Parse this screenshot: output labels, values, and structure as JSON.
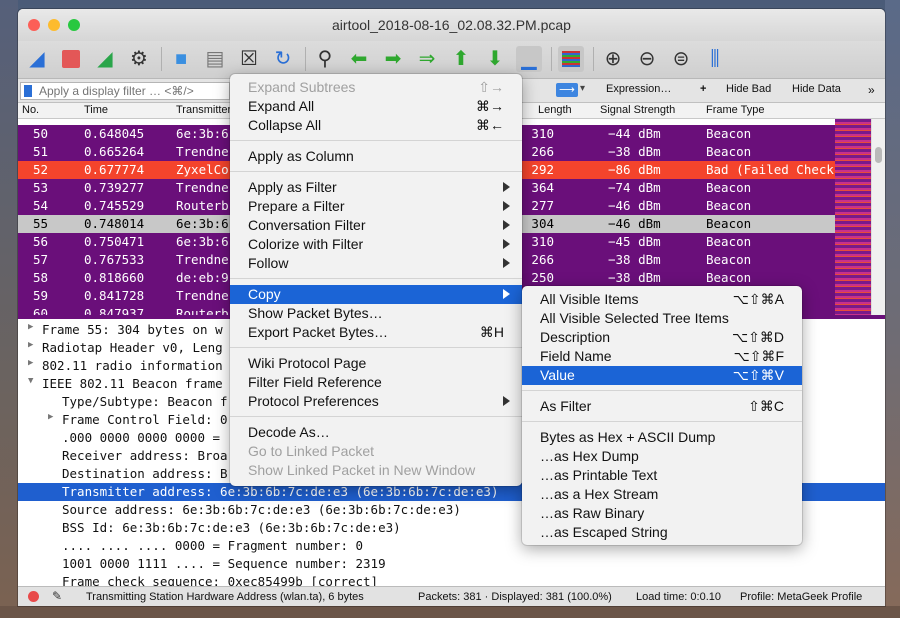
{
  "window": {
    "title": "airtool_2018-08-16_02.08.32.PM.pcap"
  },
  "filter": {
    "placeholder": "Apply a display filter … <⌘/>",
    "expression_label": "Expression…",
    "plus_label": "+",
    "hide_bad_label": "Hide Bad",
    "hide_data_label": "Hide Data"
  },
  "columns": {
    "no": "No.",
    "time": "Time",
    "transmitter": "Transmitter",
    "length": "Length",
    "signal": "Signal Strength",
    "frame_type": "Frame Type"
  },
  "packets": [
    {
      "no": "50",
      "time": "0.648045",
      "tx": "6e:3b:6",
      "len": "310",
      "sig": "−44 dBm",
      "type": "Beacon"
    },
    {
      "no": "51",
      "time": "0.665264",
      "tx": "Trendne",
      "len": "266",
      "sig": "−38 dBm",
      "type": "Beacon"
    },
    {
      "no": "52",
      "time": "0.677774",
      "tx": "ZyxelCo",
      "len": "292",
      "sig": "−86 dBm",
      "type": "Bad (Failed Check"
    },
    {
      "no": "53",
      "time": "0.739277",
      "tx": "Trendne",
      "len": "364",
      "sig": "−74 dBm",
      "type": "Beacon"
    },
    {
      "no": "54",
      "time": "0.745529",
      "tx": "Routerb",
      "len": "277",
      "sig": "−46 dBm",
      "type": "Beacon"
    },
    {
      "no": "55",
      "time": "0.748014",
      "tx": "6e:3b:6",
      "len": "304",
      "sig": "−46 dBm",
      "type": "Beacon"
    },
    {
      "no": "56",
      "time": "0.750471",
      "tx": "6e:3b:6",
      "len": "310",
      "sig": "−45 dBm",
      "type": "Beacon"
    },
    {
      "no": "57",
      "time": "0.767533",
      "tx": "Trendne",
      "len": "266",
      "sig": "−38 dBm",
      "type": "Beacon"
    },
    {
      "no": "58",
      "time": "0.818660",
      "tx": "de:eb:9",
      "len": "250",
      "sig": "−38 dBm",
      "type": "Beacon"
    },
    {
      "no": "59",
      "time": "0.841728",
      "tx": "Trendne",
      "len": "",
      "sig": "",
      "type": ""
    },
    {
      "no": "60",
      "time": "0.847937",
      "tx": "Routerb",
      "len": "",
      "sig": "",
      "type": ""
    }
  ],
  "details": [
    {
      "text": "Frame 55: 304 bytes on w",
      "tw": "▶"
    },
    {
      "text": "Radiotap Header v0, Leng",
      "tw": "▶"
    },
    {
      "text": "802.11 radio information",
      "tw": "▶"
    },
    {
      "text": "IEEE 802.11 Beacon frame",
      "tw": "▼"
    },
    {
      "text": "Type/Subtype: Beacon f",
      "tw": ""
    },
    {
      "text": "Frame Control Field: 0",
      "tw": "▶"
    },
    {
      "text": ".000 0000 0000 0000 =",
      "tw": ""
    },
    {
      "text": "Receiver address: Broa",
      "tw": ""
    },
    {
      "text": "Destination address: B",
      "tw": ""
    },
    {
      "text": "Transmitter address: 6e:3b:6b:7c:de:e3 (6e:3b:6b:7c:de:e3)",
      "tw": ""
    },
    {
      "text": "Source address: 6e:3b:6b:7c:de:e3 (6e:3b:6b:7c:de:e3)",
      "tw": ""
    },
    {
      "text": "BSS Id: 6e:3b:6b:7c:de:e3 (6e:3b:6b:7c:de:e3)",
      "tw": ""
    },
    {
      "text": ".... .... .... 0000 = Fragment number: 0",
      "tw": ""
    },
    {
      "text": "1001 0000 1111 .... = Sequence number: 2319",
      "tw": ""
    },
    {
      "text": "Frame check sequence: 0xec85499b [correct]",
      "tw": ""
    }
  ],
  "status": {
    "field": "Transmitting Station Hardware Address (wlan.ta), 6 bytes",
    "packets": "Packets: 381 · Displayed: 381 (100.0%)",
    "load": "Load time: 0:0.10",
    "profile": "Profile: MetaGeek Profile"
  },
  "context_menu": [
    {
      "label": "Expand Subtrees",
      "shortcut": "⇧→",
      "disabled": true
    },
    {
      "label": "Expand All",
      "shortcut": "⌘→"
    },
    {
      "label": "Collapse All",
      "shortcut": "⌘←"
    },
    {
      "sep": true
    },
    {
      "label": "Apply as Column",
      "shortcut": ""
    },
    {
      "sep": true
    },
    {
      "label": "Apply as Filter",
      "sub": true
    },
    {
      "label": "Prepare a Filter",
      "sub": true
    },
    {
      "label": "Conversation Filter",
      "sub": true
    },
    {
      "label": "Colorize with Filter",
      "sub": true
    },
    {
      "label": "Follow",
      "sub": true
    },
    {
      "sep": true
    },
    {
      "label": "Copy",
      "sub": true,
      "highlight": true
    },
    {
      "label": "Show Packet Bytes…",
      "shortcut": ""
    },
    {
      "label": "Export Packet Bytes…",
      "shortcut": "⌘H"
    },
    {
      "sep": true
    },
    {
      "label": "Wiki Protocol Page",
      "shortcut": ""
    },
    {
      "label": "Filter Field Reference",
      "shortcut": ""
    },
    {
      "label": "Protocol Preferences",
      "sub": true
    },
    {
      "sep": true
    },
    {
      "label": "Decode As…",
      "shortcut": ""
    },
    {
      "label": "Go to Linked Packet",
      "disabled": true
    },
    {
      "label": "Show Linked Packet in New Window",
      "disabled": true
    }
  ],
  "copy_submenu": [
    {
      "label": "All Visible Items",
      "shortcut": "⌥⇧⌘A"
    },
    {
      "label": "All Visible Selected Tree Items",
      "shortcut": ""
    },
    {
      "label": "Description",
      "shortcut": "⌥⇧⌘D"
    },
    {
      "label": "Field Name",
      "shortcut": "⌥⇧⌘F"
    },
    {
      "label": "Value",
      "shortcut": "⌥⇧⌘V",
      "highlight": true
    },
    {
      "sep": true
    },
    {
      "label": "As Filter",
      "shortcut": "⇧⌘C"
    },
    {
      "sep": true
    },
    {
      "label": "Bytes as Hex + ASCII Dump",
      "shortcut": ""
    },
    {
      "label": "…as Hex Dump",
      "shortcut": ""
    },
    {
      "label": "…as Printable Text",
      "shortcut": ""
    },
    {
      "label": "…as a Hex Stream",
      "shortcut": ""
    },
    {
      "label": "…as Raw Binary",
      "shortcut": ""
    },
    {
      "label": "…as Escaped String",
      "shortcut": ""
    }
  ],
  "colors": {
    "beacon_row": "#6a0f7a",
    "bad_row": "#f4442c",
    "selection": "#1b64d6"
  }
}
